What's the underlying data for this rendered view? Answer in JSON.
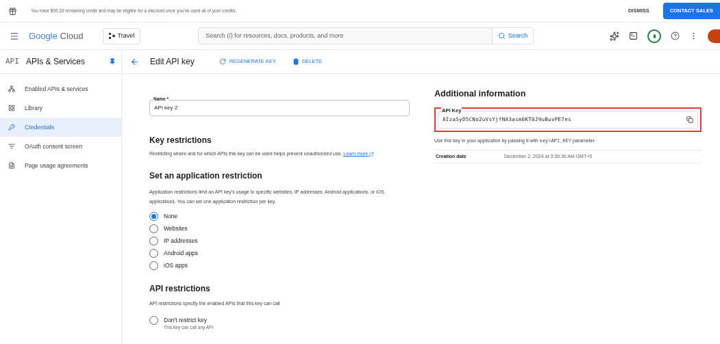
{
  "banner": {
    "message": "You have $95.39 remaining credit and may be eligible for a discount once you've used all of your credits.",
    "dismiss": "DISMISS",
    "contact": "CONTACT SALES"
  },
  "topbar": {
    "logo_google": "Google",
    "logo_cloud": "Cloud",
    "project": "Travel",
    "search_placeholder": "Search (/) for resources, docs, products, and more",
    "search_button": "Search"
  },
  "section": {
    "badge": "API",
    "title": "APIs & Services"
  },
  "page": {
    "title": "Edit API key",
    "actions": [
      "REGENERATE KEY",
      "DELETE"
    ]
  },
  "sidebar": {
    "items": [
      {
        "label": "Enabled APIs & services",
        "selected": false
      },
      {
        "label": "Library",
        "selected": false
      },
      {
        "label": "Credentials",
        "selected": true
      },
      {
        "label": "OAuth consent screen",
        "selected": false
      },
      {
        "label": "Page usage agreements",
        "selected": false
      }
    ]
  },
  "form": {
    "name_label": "Name *",
    "name_value": "API key 2",
    "key_restrictions": {
      "heading": "Key restrictions",
      "text": "Restricting where and for which APIs this key can be used helps prevent unauthorized use.",
      "link": "Learn more"
    },
    "app_restriction": {
      "heading": "Set an application restriction",
      "text": "Application restrictions limit an API key's usage to specific websites, IP addresses, Android applications, or iOS applications. You can set one application restriction per key.",
      "options": [
        {
          "label": "None",
          "selected": true
        },
        {
          "label": "Websites",
          "selected": false
        },
        {
          "label": "IP addresses",
          "selected": false
        },
        {
          "label": "Android apps",
          "selected": false
        },
        {
          "label": "iOS apps",
          "selected": false
        }
      ]
    },
    "api_restrictions": {
      "heading": "API restrictions",
      "text": "API restrictions specify the enabled APIs that this key can call",
      "options": [
        {
          "label": "Don't restrict key",
          "hint": "This key can call any API",
          "selected": false
        }
      ]
    }
  },
  "additional": {
    "heading": "Additional information",
    "key_label": "API Key",
    "key_value": "AIzaSyD5CNo2uVsYjfNA3asm0KT0J9uBuvPE7es",
    "highlighted": true,
    "usage_before": "Use this key in your application by passing it with",
    "usage_code": "key=API_KEY",
    "usage_after": "parameter.",
    "creation_label": "Creation date",
    "creation_value": "December 2, 2024 at 3:39:30 AM GMT+5"
  }
}
